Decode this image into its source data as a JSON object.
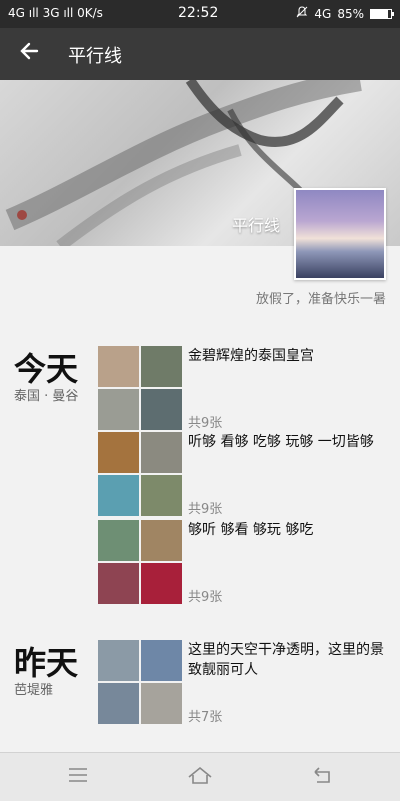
{
  "status_bar": {
    "left": "4G ıll 3G ıll 0K/s",
    "time": "22:52",
    "network_right": "4G",
    "battery": "85%",
    "battery_level": 0.85,
    "icons": [
      "signal-icon",
      "notification-mute-icon",
      "battery-icon"
    ]
  },
  "appbar": {
    "title": "平行线",
    "back_icon": "back-arrow-icon"
  },
  "profile": {
    "name": "平行线",
    "signature": "放假了，准备快乐一暑"
  },
  "days": [
    {
      "title": "今天",
      "location": "泰国 · 曼谷",
      "posts": [
        {
          "text": "金碧辉煌的泰国皇宫",
          "count": "共9张",
          "thumb_colors": [
            "#b9a18a",
            "#6f7b68",
            "#9a9c94",
            "#5d6d70"
          ]
        },
        {
          "text": "听够 看够 吃够 玩够 一切皆够",
          "count": "共9张",
          "thumb_colors": [
            "#a4733e",
            "#8b8a80",
            "#5b9fb1",
            "#7d8a6a"
          ]
        },
        {
          "text": "够听 够看 够玩 够吃",
          "count": "共9张",
          "thumb_colors": [
            "#6e8f74",
            "#a08563",
            "#8e4452",
            "#a8203a"
          ]
        }
      ]
    },
    {
      "title": "昨天",
      "location": "芭堤雅",
      "posts": [
        {
          "text": "这里的天空干净透明，这里的景致靓丽可人",
          "count": "共7张",
          "thumb_colors": [
            "#8b9aa6",
            "#6e87a7",
            "#77889a",
            "#a6a39c"
          ]
        }
      ]
    }
  ],
  "navbar": {
    "menu_icon": "menu-icon",
    "home_icon": "home-icon",
    "back_icon": "return-icon"
  }
}
